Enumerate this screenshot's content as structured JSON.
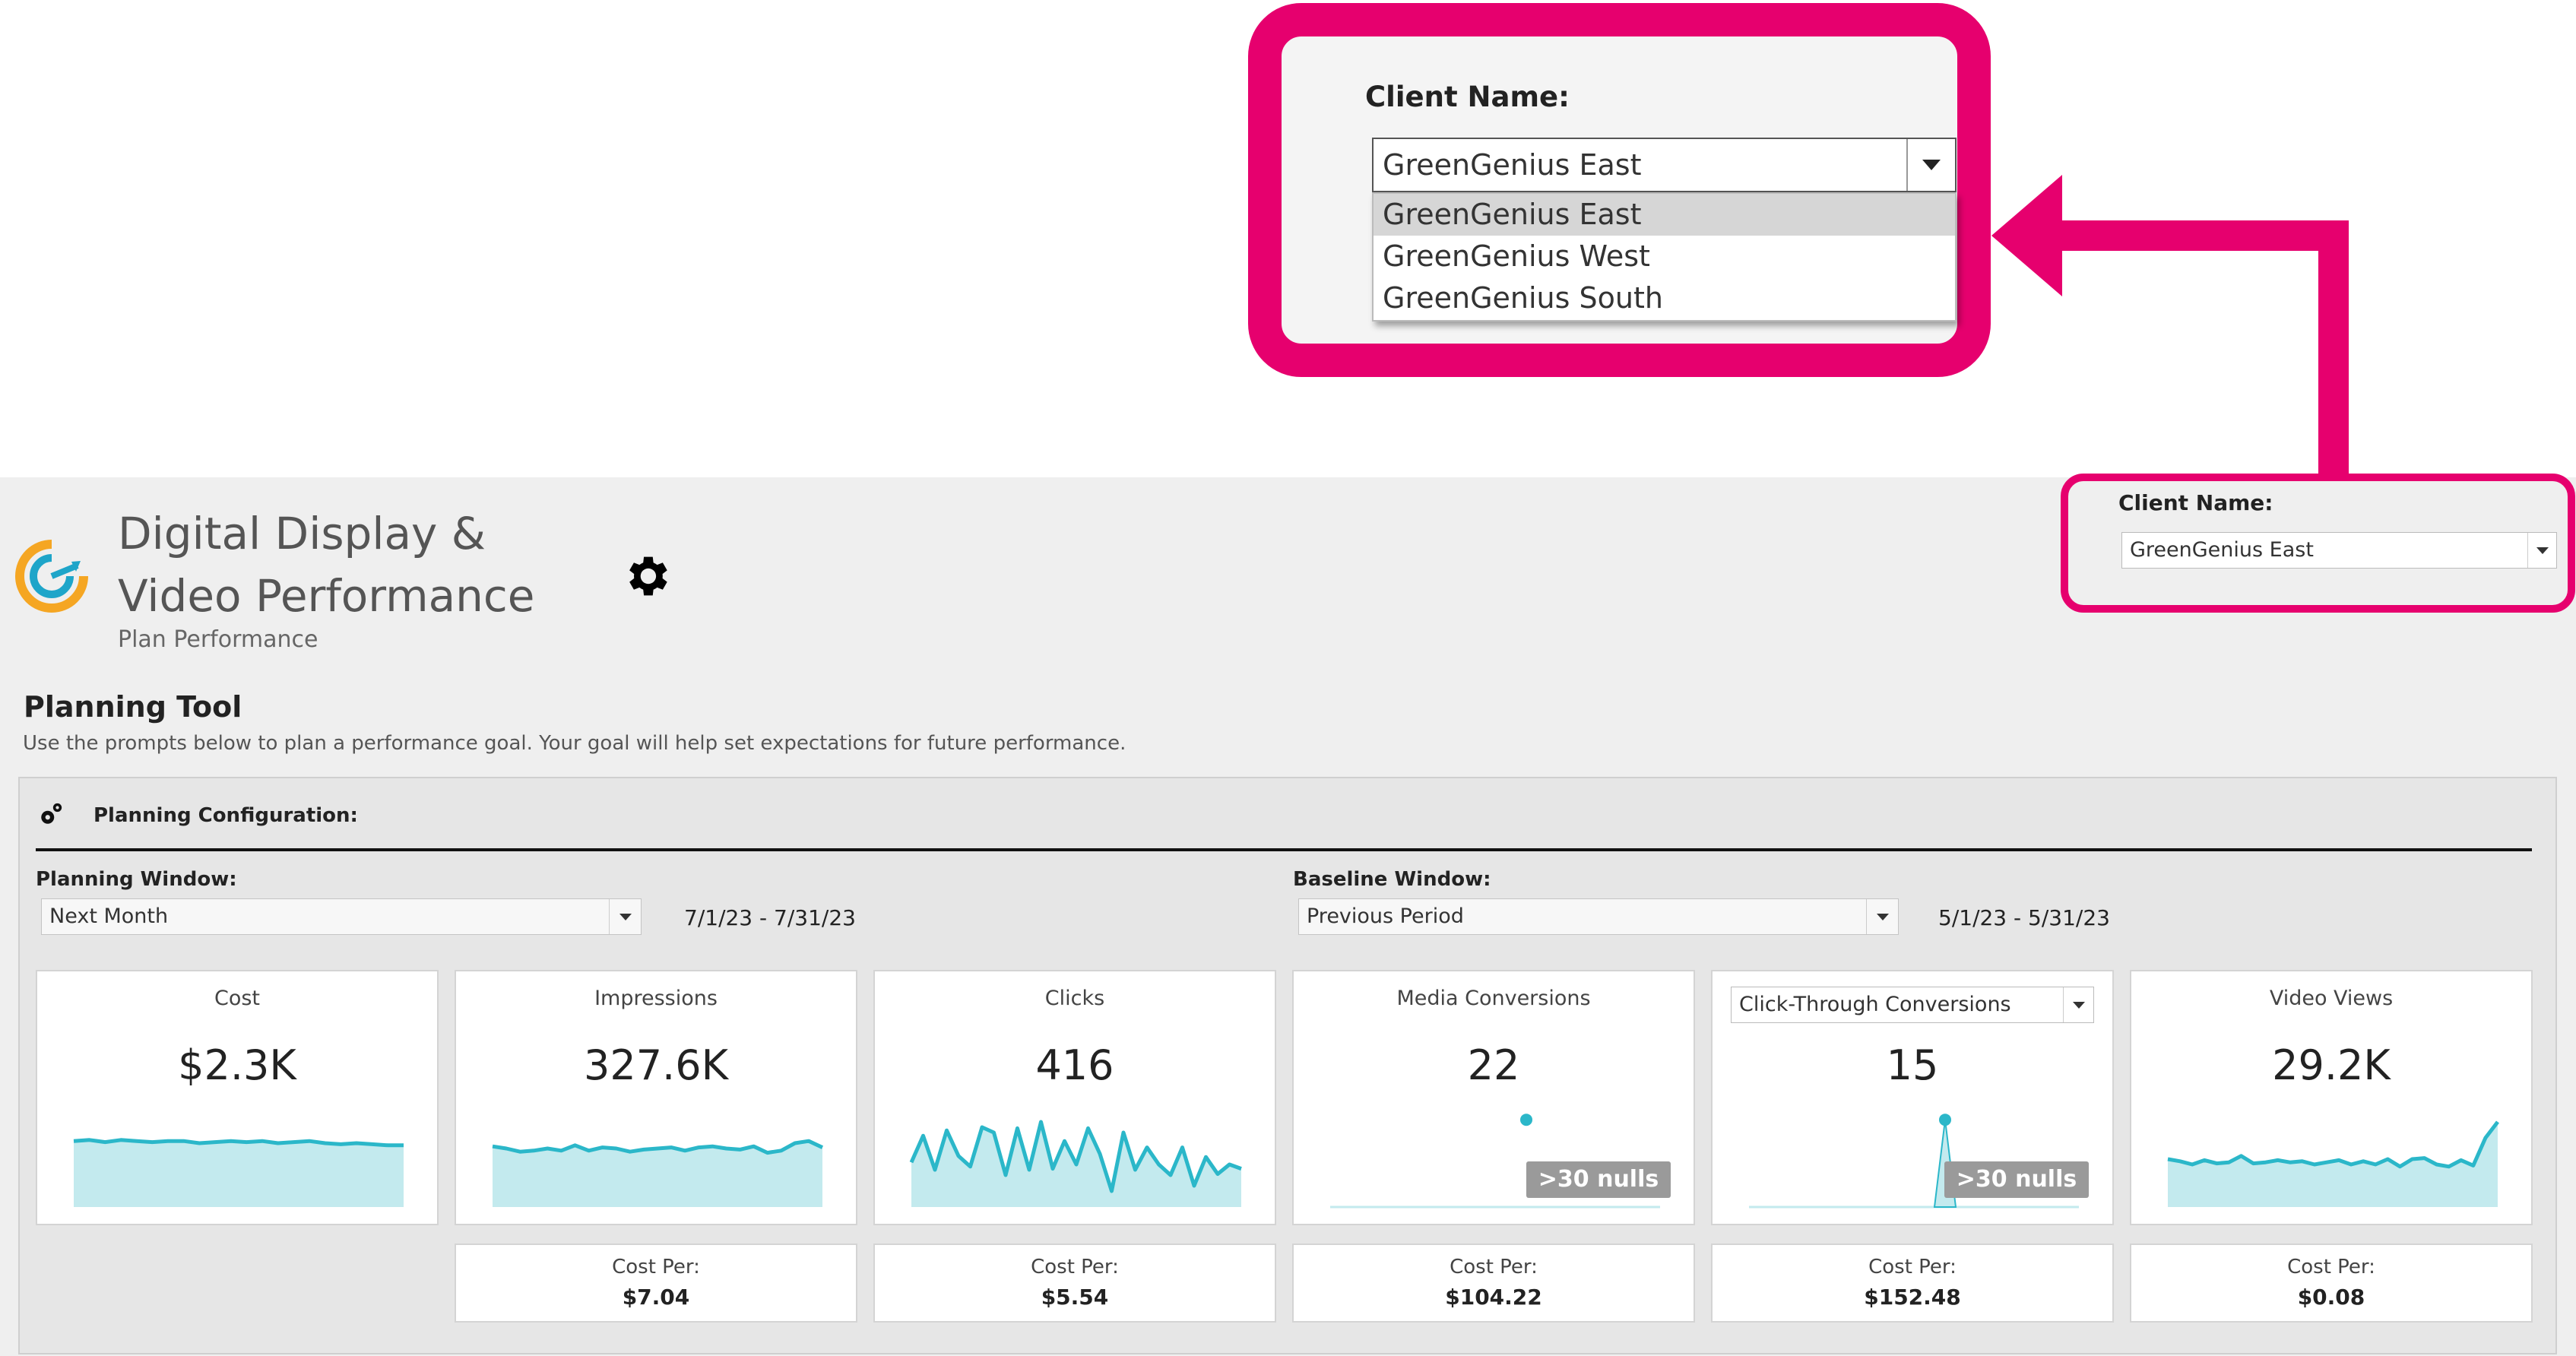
{
  "callout": {
    "label": "Client Name:",
    "selected": "GreenGenius East",
    "options": [
      "GreenGenius East",
      "GreenGenius West",
      "GreenGenius South"
    ]
  },
  "header": {
    "title_line1": "Digital Display &",
    "title_line2": "Video Performance",
    "subtitle": "Plan Performance",
    "logo_icon": "target-arrow-icon",
    "settings_icon": "gear-icon"
  },
  "client_filter": {
    "label": "Client Name:",
    "value": "GreenGenius East"
  },
  "planning_tool": {
    "title": "Planning Tool",
    "description": "Use the prompts below to plan a performance goal. Your goal will help set expectations for future performance.",
    "config_title": "Planning Configuration:",
    "planning_window": {
      "label": "Planning Window:",
      "value": "Next Month",
      "range": "7/1/23 - 7/31/23"
    },
    "baseline_window": {
      "label": "Baseline Window:",
      "value": "Previous Period",
      "range": "5/1/23 - 5/31/23"
    }
  },
  "kpis": [
    {
      "title": "Cost",
      "value": "$2.3K",
      "trend": [
        0.62,
        0.63,
        0.61,
        0.63,
        0.62,
        0.61,
        0.62,
        0.62,
        0.6,
        0.61,
        0.62,
        0.61,
        0.62,
        0.6,
        0.61,
        0.62,
        0.6,
        0.59,
        0.6,
        0.59,
        0.58,
        0.58
      ]
    },
    {
      "title": "Impressions",
      "value": "327.6K",
      "trend": [
        0.57,
        0.55,
        0.52,
        0.53,
        0.55,
        0.53,
        0.58,
        0.53,
        0.56,
        0.55,
        0.52,
        0.54,
        0.55,
        0.56,
        0.53,
        0.56,
        0.57,
        0.55,
        0.54,
        0.57,
        0.51,
        0.53,
        0.6,
        0.62,
        0.56
      ]
    },
    {
      "title": "Clicks",
      "value": "416",
      "trend": [
        0.42,
        0.67,
        0.35,
        0.72,
        0.48,
        0.38,
        0.75,
        0.7,
        0.3,
        0.74,
        0.35,
        0.8,
        0.36,
        0.62,
        0.4,
        0.74,
        0.5,
        0.15,
        0.7,
        0.35,
        0.56,
        0.4,
        0.3,
        0.56,
        0.2,
        0.47,
        0.31,
        0.4,
        0.36
      ]
    },
    {
      "title": "Media Conversions",
      "value": "22",
      "nulls": ">30 nulls",
      "point": 0.82
    },
    {
      "title": "Click-Through Conversions",
      "value": "15",
      "nulls": ">30 nulls",
      "spike": 0.82
    },
    {
      "title": "Video Views",
      "value": "29.2K",
      "trend": [
        0.45,
        0.43,
        0.4,
        0.44,
        0.41,
        0.42,
        0.48,
        0.41,
        0.42,
        0.44,
        0.42,
        0.43,
        0.4,
        0.42,
        0.44,
        0.4,
        0.43,
        0.4,
        0.45,
        0.38,
        0.45,
        0.46,
        0.4,
        0.38,
        0.44,
        0.39,
        0.65,
        0.8
      ]
    }
  ],
  "cost_per": [
    {
      "label": "Cost Per:",
      "value": "$7.04"
    },
    {
      "label": "Cost Per:",
      "value": "$5.54"
    },
    {
      "label": "Cost Per:",
      "value": "$104.22"
    },
    {
      "label": "Cost Per:",
      "value": "$152.48"
    },
    {
      "label": "Cost Per:",
      "value": "$0.08"
    }
  ],
  "colors": {
    "accent": "#e6006e",
    "sparkline_line": "#2bb7c9",
    "sparkline_fill": "#c3eaee",
    "logo_orange": "#f5a623",
    "logo_blue": "#1ea5c9"
  }
}
